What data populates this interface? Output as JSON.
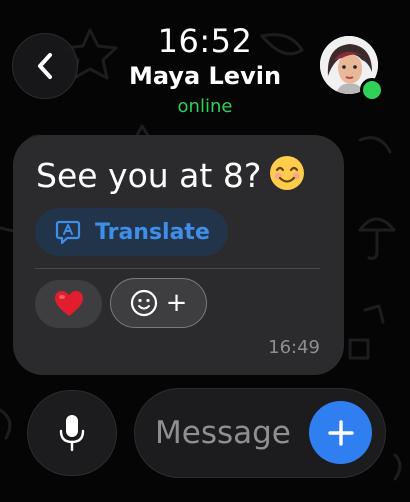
{
  "header": {
    "time": "16:52",
    "contact_name": "Maya Levin",
    "status": "online"
  },
  "message": {
    "text": "See you at 8?",
    "emoji": "smiling-face-with-smiling-eyes",
    "translate_label": "Translate",
    "reactions": [
      "❤️"
    ],
    "time": "16:49"
  },
  "composer": {
    "placeholder": "Message"
  },
  "colors": {
    "online": "#30d158",
    "accent": "#2f7ff0",
    "translate_text": "#3f8fe8",
    "bubble": "#2b2b2d"
  },
  "icons": {
    "back": "chevron-left-icon",
    "translate": "translate-bubble-icon",
    "add_reaction": "smiley-plus-icon",
    "mic": "microphone-icon",
    "send": "plus-icon"
  }
}
